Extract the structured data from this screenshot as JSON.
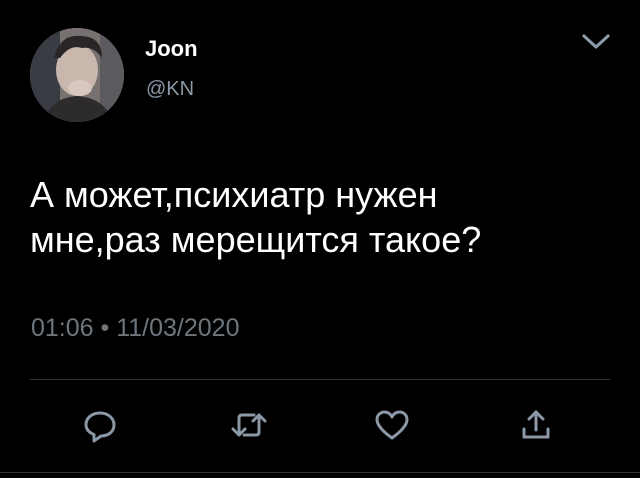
{
  "colors": {
    "background": "#000000",
    "text_primary": "#ffffff",
    "text_secondary": "#8b98a5",
    "icon": "#8b98a5",
    "divider": "#2f3336"
  },
  "author": {
    "display_name": "Joon",
    "handle": "@KN",
    "avatar": "avatar-photo"
  },
  "tweet": {
    "text": "А может,психиатр нужен\nмне,раз мерещится такое?",
    "timestamp": "01:06 • 11/03/2020"
  },
  "actions": [
    {
      "icon": "reply-icon"
    },
    {
      "icon": "retweet-icon"
    },
    {
      "icon": "heart-icon"
    },
    {
      "icon": "share-icon"
    }
  ],
  "menu": {
    "icon": "chevron-down-icon"
  }
}
